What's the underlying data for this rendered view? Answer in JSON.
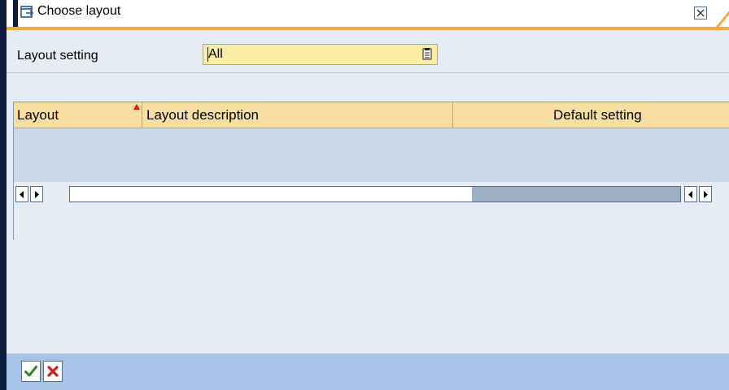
{
  "window": {
    "title": "Choose layout",
    "icons": {
      "title_icon": "choose-layout-icon",
      "close": "close-icon"
    }
  },
  "form": {
    "layout_setting_label": "Layout setting",
    "layout_setting_value": "All"
  },
  "table": {
    "columns": [
      "Layout",
      "Layout description",
      "Default setting"
    ],
    "rows": []
  },
  "footer": {
    "buttons": [
      {
        "icon": "checkmark-icon",
        "color": "#2f8a1f"
      },
      {
        "icon": "cancel-x-icon",
        "color": "#d21c1c"
      }
    ]
  },
  "colors": {
    "accent_orange": "#f0a93a",
    "header_bg": "#f8dfa0",
    "input_bg": "#fbeea3",
    "footer_bg": "#a7c3e6",
    "body_bg": "#e6ecf3",
    "row_bg": "#cbd9e6"
  }
}
